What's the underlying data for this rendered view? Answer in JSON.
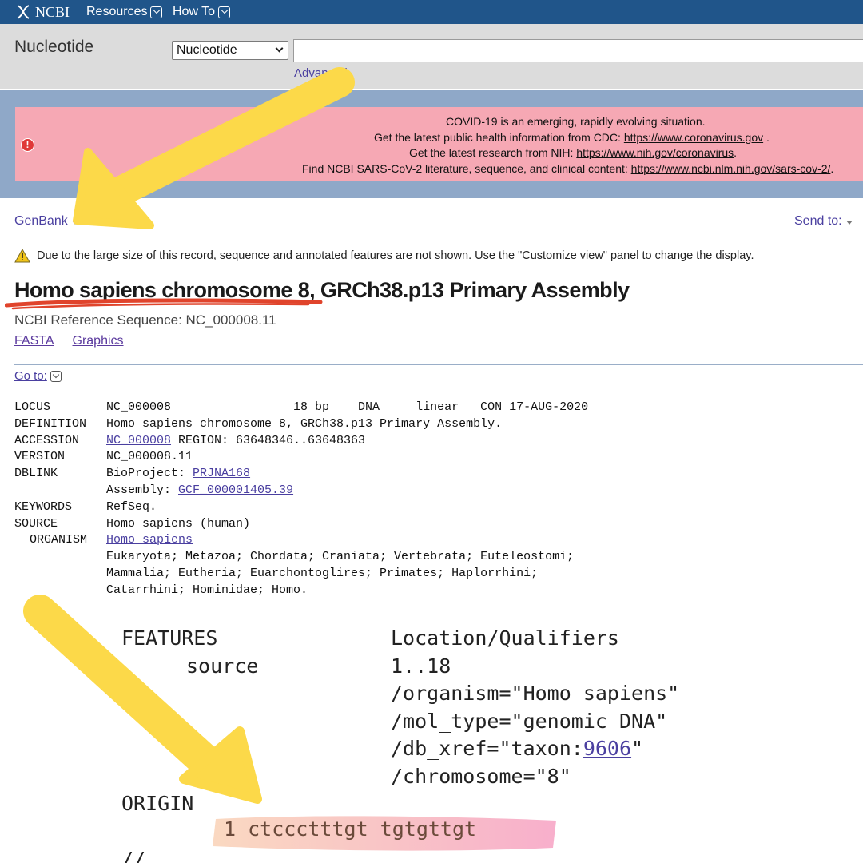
{
  "nav": {
    "logo_text": "NCBI",
    "resources_label": "Resources",
    "howto_label": "How To"
  },
  "search": {
    "db_title": "Nucleotide",
    "db_select_value": "Nucleotide",
    "advanced_label": "Advanced"
  },
  "alert": {
    "line1": "COVID-19 is an emerging, rapidly evolving situation.",
    "line2_text": "Get the latest public health information from CDC: ",
    "line2_link": "https://www.coronavirus.gov",
    "line2_tail": " .",
    "line3_text": "Get the latest research from NIH: ",
    "line3_link": "https://www.nih.gov/coronavirus",
    "line3_tail": ".",
    "line4_text": "Find NCBI SARS-CoV-2 literature, sequence, and clinical content: ",
    "line4_link": "https://www.ncbi.nlm.nih.gov/sars-cov-2/",
    "line4_tail": "."
  },
  "controls": {
    "format_label": "GenBank",
    "sendto_label": "Send to:",
    "warning": "Due to the large size of this record, sequence and annotated features are not shown. Use the \"Customize view\" panel to change the display."
  },
  "record": {
    "title": "Homo sapiens chromosome 8, GRCh38.p13 Primary Assembly",
    "ref_seq": "NCBI Reference Sequence: NC_000008.11",
    "fasta_link": "FASTA",
    "graphics_link": "Graphics",
    "goto_label": "Go to:"
  },
  "flatfile": {
    "locus_key": "LOCUS",
    "locus_val": "NC_000008                 18 bp    DNA     linear   CON 17-AUG-2020",
    "definition_key": "DEFINITION",
    "definition_val": "Homo sapiens chromosome 8, GRCh38.p13 Primary Assembly.",
    "accession_key": "ACCESSION",
    "accession_link": "NC_000008",
    "accession_tail": " REGION: 63648346..63648363",
    "version_key": "VERSION",
    "version_val": "NC_000008.11",
    "dblink_key": "DBLINK",
    "bioproject_label": "BioProject: ",
    "bioproject_link": "PRJNA168",
    "assembly_label": "Assembly: ",
    "assembly_link": "GCF_000001405.39",
    "keywords_key": "KEYWORDS",
    "keywords_val": "RefSeq.",
    "source_key": "SOURCE",
    "source_val": "Homo sapiens (human)",
    "organism_key": "ORGANISM",
    "organism_link": "Homo sapiens",
    "lineage1": "Eukaryota; Metazoa; Chordata; Craniata; Vertebrata; Euteleostomi;",
    "lineage2": "Mammalia; Eutheria; Euarchontoglires; Primates; Haplorrhini;",
    "lineage3": "Catarrhini; Hominidae; Homo."
  },
  "features": {
    "features_key": "FEATURES",
    "location_header": "Location/Qualifiers",
    "source_key": "source",
    "range": "1..18",
    "organism_q": "/organism=\"Homo sapiens\"",
    "moltype_q": "/mol_type=\"genomic DNA\"",
    "dbxref_prefix": "/db_xref=\"taxon:",
    "dbxref_link": "9606",
    "dbxref_suffix": "\"",
    "chromosome_q": "/chromosome=\"8\"",
    "origin_key": "ORIGIN",
    "sequence_line": "1 ctccctttgt tgtgttgt",
    "terminator": "//"
  },
  "colors": {
    "nav_blue": "#20558a",
    "alert_pink": "#f6a8b4",
    "link_purple": "#4a3fa0",
    "arrow_yellow": "#fcd949",
    "underline_red": "#e0442c"
  }
}
